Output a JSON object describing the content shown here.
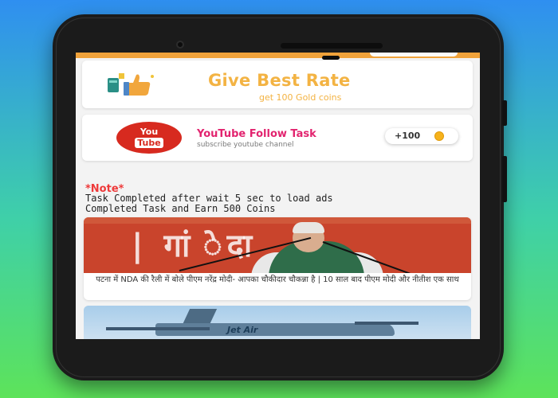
{
  "rate_card": {
    "title": "Give Best Rate",
    "subtitle": "get 100 Gold coins",
    "icon": "thumbs-up-wallet-icon"
  },
  "youtube_card": {
    "logo_you": "You",
    "logo_tube": "Tube",
    "title": "YouTube Follow Task",
    "subtitle": "subscribe youtube channel",
    "reward": "+100",
    "reward_icon": "gold-coin-icon"
  },
  "note": {
    "label": "*Note*",
    "line1": "Task Completed after wait 5 sec to load ads",
    "line2": "Completed Task and Earn 500 Coins"
  },
  "news": [
    {
      "banner_text": "| गां     ेदा",
      "caption": "पटना में NDA की रैली में बोले पीएम नरेंद्र मोदी- आपका चौकीदार चौकन्ना है | 10 साल बाद पीएम मोदी और नीतीश एक साथ"
    },
    {
      "banner_text": "Jet Air"
    }
  ],
  "colors": {
    "accent_orange": "#f0a23a",
    "gold_text": "#f3b343",
    "youtube_red": "#d72a1f",
    "pink_title": "#e2246f",
    "note_red": "#ee3a3a"
  }
}
